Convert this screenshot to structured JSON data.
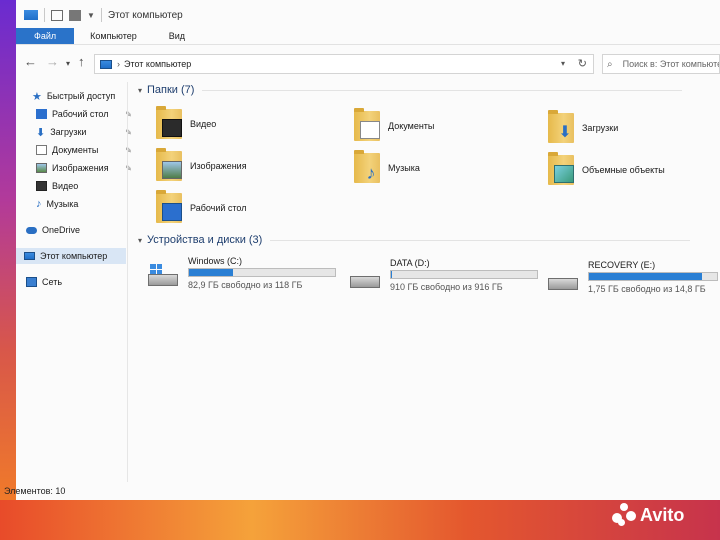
{
  "window": {
    "title": "Этот компьютер"
  },
  "ribbon": {
    "tabs": [
      "Файл",
      "Компьютер",
      "Вид"
    ]
  },
  "address": {
    "path": "Этот компьютер",
    "search_placeholder": "Поиск в: Этот компьютер"
  },
  "sidebar": {
    "items": [
      {
        "label": "Быстрый доступ",
        "icon": "star-icon",
        "pinned": false
      },
      {
        "label": "Рабочий стол",
        "icon": "desktop-icon",
        "pinned": true
      },
      {
        "label": "Загрузки",
        "icon": "download-icon",
        "pinned": true
      },
      {
        "label": "Документы",
        "icon": "documents-icon",
        "pinned": true
      },
      {
        "label": "Изображения",
        "icon": "pictures-icon",
        "pinned": true
      },
      {
        "label": "Видео",
        "icon": "video-icon",
        "pinned": false
      },
      {
        "label": "Музыка",
        "icon": "music-icon",
        "pinned": false
      },
      {
        "label": "OneDrive",
        "icon": "cloud-icon",
        "pinned": false
      },
      {
        "label": "Этот компьютер",
        "icon": "computer-icon",
        "pinned": false
      },
      {
        "label": "Сеть",
        "icon": "network-icon",
        "pinned": false
      }
    ]
  },
  "folders": {
    "header": "Папки (7)",
    "items": [
      {
        "name": "Видео",
        "overlay": "video"
      },
      {
        "name": "Документы",
        "overlay": "document"
      },
      {
        "name": "Загрузки",
        "overlay": "download"
      },
      {
        "name": "Изображения",
        "overlay": "picture"
      },
      {
        "name": "Музыка",
        "overlay": "music"
      },
      {
        "name": "Объемные объекты",
        "overlay": "3d"
      },
      {
        "name": "Рабочий стол",
        "overlay": "desktop"
      }
    ]
  },
  "drives": {
    "header": "Устройства и диски (3)",
    "items": [
      {
        "name": "Windows (C:)",
        "free": "82,9 ГБ свободно из 118 ГБ",
        "used_fraction": 0.3,
        "system": true
      },
      {
        "name": "DATA (D:)",
        "free": "910 ГБ свободно из 916 ГБ",
        "used_fraction": 0.007,
        "system": false
      },
      {
        "name": "RECOVERY (E:)",
        "free": "1,75 ГБ свободно из 14,8 ГБ",
        "used_fraction": 0.88,
        "system": false
      }
    ]
  },
  "status": {
    "text": "Элементов: 10"
  },
  "watermark": {
    "text": "Avito"
  },
  "colors": {
    "accent": "#2a73c9",
    "bar_fill": "#2a7fd4",
    "folder": "#f3d27a"
  }
}
